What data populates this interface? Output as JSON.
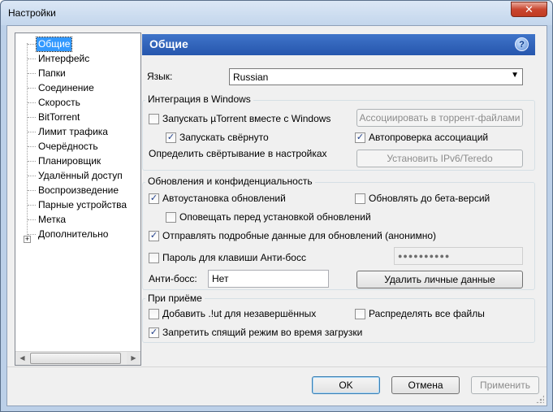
{
  "window": {
    "title": "Настройки",
    "close_glyph": "✕"
  },
  "tree": {
    "items": [
      {
        "label": "Общие",
        "selected": true
      },
      {
        "label": "Интерфейс"
      },
      {
        "label": "Папки"
      },
      {
        "label": "Соединение"
      },
      {
        "label": "Скорость"
      },
      {
        "label": "BitTorrent"
      },
      {
        "label": "Лимит трафика"
      },
      {
        "label": "Очерёдность"
      },
      {
        "label": "Планировщик"
      },
      {
        "label": "Удалённый доступ"
      },
      {
        "label": "Воспроизведение"
      },
      {
        "label": "Парные устройства"
      },
      {
        "label": "Метка"
      },
      {
        "label": "Дополнительно",
        "expandable": true
      }
    ],
    "expander_glyph": "+"
  },
  "header": {
    "title": "Общие",
    "help_glyph": "?"
  },
  "language": {
    "label": "Язык:",
    "value": "Russian",
    "arrow": "▼"
  },
  "windows_group": {
    "title": "Интеграция в Windows",
    "start_with_windows": {
      "label": "Запускать µTorrent вместе с Windows",
      "checked": false
    },
    "start_minimized": {
      "label": "Запускать свёрнуто",
      "checked": true
    },
    "associate_button": "Ассоциировать в торрент-файлами",
    "auto_check_assoc": {
      "label": "Автопроверка ассоциаций",
      "checked": true
    },
    "minimize_text": "Определить свёртывание в настройках",
    "ipv6_button": "Установить IPv6/Teredo"
  },
  "updates_group": {
    "title": "Обновления и конфиденциальность",
    "auto_install": {
      "label": "Автоустановка обновлений",
      "checked": true
    },
    "beta": {
      "label": "Обновлять до бета-версий",
      "checked": false
    },
    "notify_before": {
      "label": "Оповещать перед установкой обновлений",
      "checked": false
    },
    "send_details": {
      "label": "Отправлять подробные данные для обновлений (анонимно)",
      "checked": true
    },
    "boss_password": {
      "label": "Пароль для клавиши Анти-босс",
      "checked": false
    },
    "password_value": "●●●●●●●●●●",
    "boss_label": "Анти-босс:",
    "boss_value": "Нет",
    "delete_button": "Удалить личные данные"
  },
  "receive_group": {
    "title": "При приёме",
    "add_ut": {
      "label": "Добавить .!ut для незавершённых",
      "checked": false
    },
    "distribute": {
      "label": "Распределять все файлы",
      "checked": false
    },
    "no_sleep": {
      "label": "Запретить спящий режим во время загрузки",
      "checked": true
    }
  },
  "footer": {
    "ok": "OK",
    "cancel": "Отмена",
    "apply": "Применить"
  },
  "check_glyph": "✓",
  "scroll": {
    "left": "◀",
    "right": "▶"
  }
}
